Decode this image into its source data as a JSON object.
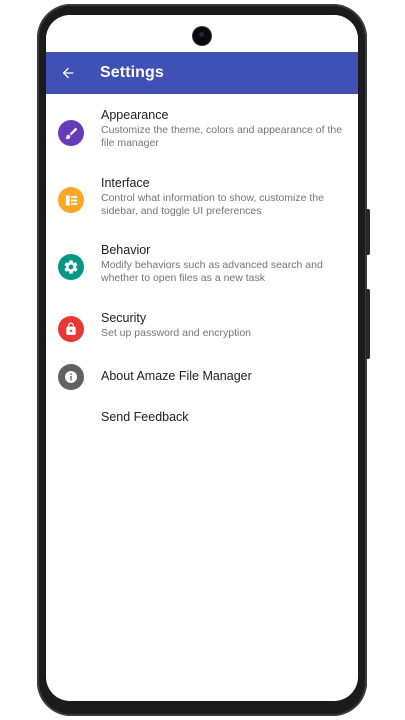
{
  "app_bar": {
    "title": "Settings",
    "back_icon": "arrow-back-icon",
    "color": "#3f51b5"
  },
  "items": [
    {
      "title": "Appearance",
      "subtitle": "Customize the theme, colors and appearance of the file manager",
      "icon": "paintbrush-icon",
      "color": "#673ab7"
    },
    {
      "title": "Interface",
      "subtitle": "Control what information to show, customize the sidebar, and toggle UI preferences",
      "icon": "interface-icon",
      "color": "#f9a825"
    },
    {
      "title": "Behavior",
      "subtitle": "Modify behaviors such as advanced search and whether to open files as a new task",
      "icon": "gear-icon",
      "color": "#009688"
    },
    {
      "title": "Security",
      "subtitle": "Set up password and encryption",
      "icon": "lock-icon",
      "color": "#e53935"
    },
    {
      "title": "About Amaze File Manager",
      "subtitle": "",
      "icon": "info-icon",
      "color": "#616161"
    },
    {
      "title": "Send Feedback",
      "subtitle": "",
      "icon": "",
      "color": ""
    }
  ]
}
